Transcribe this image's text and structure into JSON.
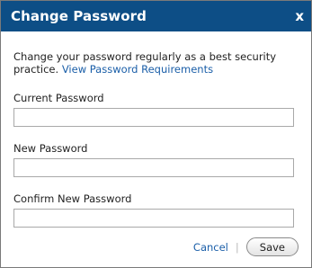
{
  "dialog": {
    "title": "Change Password",
    "close_glyph": "x",
    "close_icon": "close-icon"
  },
  "intro": {
    "text": "Change your password regularly as a best security practice.",
    "link": "View Password Requirements"
  },
  "fields": {
    "current": {
      "label": "Current Password",
      "value": ""
    },
    "new": {
      "label": "New Password",
      "value": ""
    },
    "confirm": {
      "label": "Confirm New Password",
      "value": ""
    }
  },
  "footer": {
    "cancel_label": "Cancel",
    "separator": "|",
    "save_label": "Save"
  },
  "colors": {
    "titlebar": "#0d4e86",
    "link": "#1a5ea8"
  }
}
